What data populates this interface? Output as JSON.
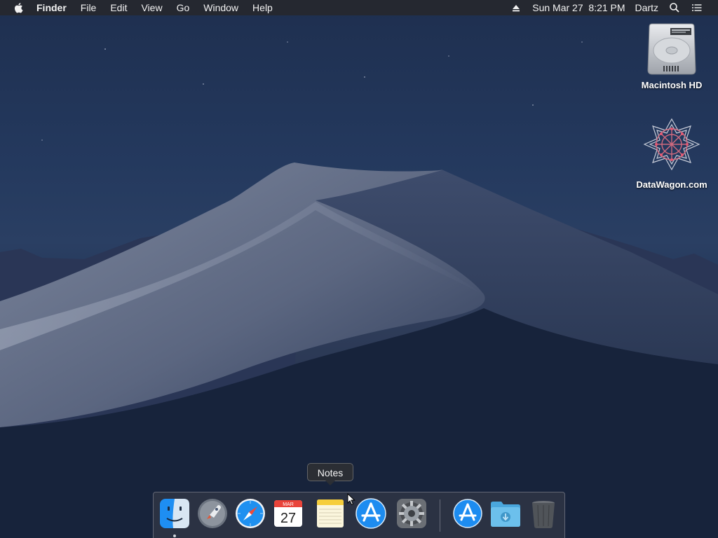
{
  "menubar": {
    "apple_icon": "apple-icon",
    "app_name": "Finder",
    "menus": [
      "File",
      "Edit",
      "View",
      "Go",
      "Window",
      "Help"
    ],
    "eject_icon": "eject-icon",
    "datetime": "Sun Mar 27  8:21 PM",
    "user": "Dartz",
    "search_icon": "spotlight-search-icon",
    "notification_icon": "notification-center-icon"
  },
  "desktop": {
    "icons": [
      {
        "label": "Macintosh HD",
        "icon": "hard-drive-icon"
      },
      {
        "label": "DataWagon.com",
        "icon": "network-volume-icon"
      }
    ]
  },
  "dock": {
    "tooltip": "Notes",
    "apps": [
      {
        "name": "Finder",
        "icon": "finder-icon"
      },
      {
        "name": "Launchpad",
        "icon": "launchpad-icon"
      },
      {
        "name": "Safari",
        "icon": "safari-icon"
      },
      {
        "name": "Calendar",
        "icon": "calendar-icon",
        "month": "MAR",
        "day": "27"
      },
      {
        "name": "Notes",
        "icon": "notes-icon"
      },
      {
        "name": "App Store",
        "icon": "app-store-icon"
      },
      {
        "name": "System Preferences",
        "icon": "system-preferences-icon"
      },
      {
        "name": "App Store Downloads",
        "icon": "app-store-icon"
      },
      {
        "name": "Downloads",
        "icon": "downloads-folder-icon"
      },
      {
        "name": "Trash",
        "icon": "trash-icon"
      }
    ]
  },
  "colors": {
    "menubar_bg": "#26282e",
    "wallpaper_sky": "#24395e",
    "dune_light": "#8c95aa",
    "app_store_blue": "#1d8cf0"
  }
}
